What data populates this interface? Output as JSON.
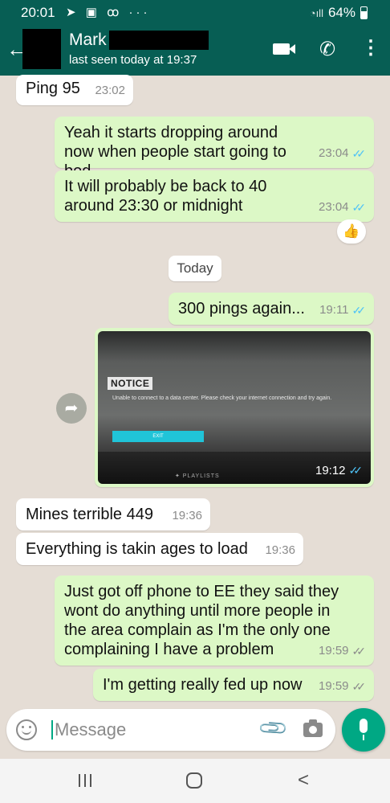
{
  "status_bar": {
    "time": "20:01",
    "icons": [
      "send-icon",
      "gallery-icon",
      "voicemail-icon",
      "more-dots-icon"
    ],
    "left_icons_text": "➤ ▣ ꝏ ···",
    "battery": "64%"
  },
  "header": {
    "back_glyph": "←",
    "contact_name": "Mark",
    "last_seen": "last seen today at 19:37",
    "call_glyph": "✆",
    "menu_glyph": "⋮"
  },
  "messages": [
    {
      "direction": "in",
      "text": "Ping 95",
      "time": "23:02"
    },
    {
      "direction": "out",
      "text": "Yeah it starts dropping around now when people start going to bed",
      "time": "23:04",
      "status": "read"
    },
    {
      "direction": "out",
      "text": "It will probably be back to 40 around 23:30 or midnight",
      "time": "23:04",
      "status": "read",
      "reaction": "👍"
    },
    {
      "direction": "out",
      "text": "300 pings again...",
      "time": "19:11",
      "status": "read"
    },
    {
      "direction": "out",
      "type": "image",
      "time": "19:12",
      "status": "read",
      "image": {
        "notice_title": "NOTICE",
        "notice_message": "Unable to connect to a data center. Please check your internet connection and try again.",
        "button_label": "EXIT",
        "footer_label": "✦ PLAYLISTS"
      }
    },
    {
      "direction": "in",
      "text": "Mines terrible 449",
      "time": "19:36"
    },
    {
      "direction": "in",
      "text": "Everything is takin ages to load",
      "time": "19:36"
    },
    {
      "direction": "out",
      "text": "Just got off phone to EE they said they wont do anything until more people in the area complain as I'm the only one complaining I have a problem",
      "time": "19:59",
      "status": "delivered"
    },
    {
      "direction": "out",
      "text": "I'm getting really fed up now",
      "time": "19:59",
      "status": "delivered"
    }
  ],
  "date_chip": "Today",
  "tick_glyph": "✓✓",
  "forward_glyph": "➦",
  "input": {
    "placeholder": "Message",
    "attach_glyph": "📎"
  },
  "navbar": {
    "back_glyph": "<"
  },
  "colors": {
    "header": "#075e54",
    "outgoing_bubble": "#dcf8c6",
    "incoming_bubble": "#ffffff",
    "accent": "#00a884",
    "read_tick": "#4fc3f7"
  }
}
